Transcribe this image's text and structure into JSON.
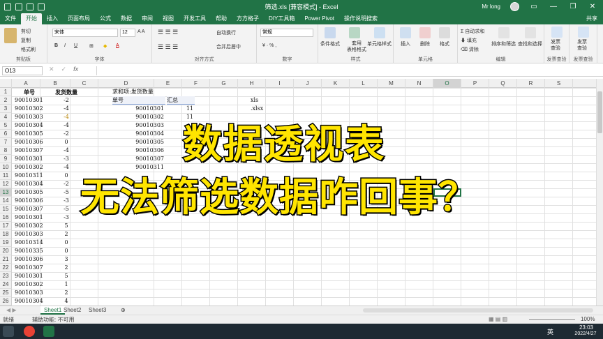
{
  "window": {
    "title": "筛选.xls [兼容模式] - Excel",
    "user": "Mr long",
    "share": "共享"
  },
  "tabs": [
    "文件",
    "开始",
    "插入",
    "页面布局",
    "公式",
    "数据",
    "审阅",
    "视图",
    "开发工具",
    "帮助",
    "方方格子",
    "DIY工具箱",
    "Power Pivot",
    "操作说明搜索"
  ],
  "ribbon": {
    "clipboard": {
      "label": "剪贴板",
      "cut": "剪切",
      "copy": "复制",
      "painter": "格式刷"
    },
    "font": {
      "label": "字体",
      "name": "宋体",
      "size": "12"
    },
    "align": {
      "label": "对齐方式",
      "wrap": "自动换行",
      "merge": "合并后居中"
    },
    "number": {
      "label": "数字",
      "format": "常规"
    },
    "styles": {
      "label": "样式",
      "cond": "条件格式",
      "table": "套用\n表格格式",
      "cell": "单元格样式"
    },
    "cells": {
      "label": "单元格",
      "insert": "插入",
      "delete": "删除",
      "format": "格式"
    },
    "editing": {
      "label": "编辑",
      "autosum": "自动求和",
      "fill": "填充",
      "clear": "清除",
      "sort": "排序和筛选",
      "find": "查找和选择"
    },
    "invoice1": {
      "label": "发票查验",
      "btn": "发票\n查验"
    },
    "invoice2": {
      "label": "发票查验",
      "btn": "发票\n查验"
    }
  },
  "namebox": "O13",
  "columns": [
    "A",
    "B",
    "C",
    "D",
    "E",
    "F",
    "G",
    "H",
    "I",
    "J",
    "K",
    "L",
    "M",
    "N",
    "O",
    "P",
    "Q",
    "R",
    "S"
  ],
  "rows": [
    "1",
    "2",
    "3",
    "4",
    "5",
    "6",
    "7",
    "8",
    "9",
    "10",
    "11",
    "12",
    "13",
    "14",
    "15",
    "16",
    "17",
    "18",
    "19",
    "20",
    "21",
    "22",
    "23",
    "24",
    "25",
    "26",
    "27"
  ],
  "sheet": {
    "colA": [
      "单号",
      "90010301",
      "90010302",
      "90010303",
      "90010304",
      "90010305",
      "90010306",
      "90010307",
      "90010301",
      "90010302",
      "90010311",
      "90010304",
      "90010305",
      "90010306",
      "90010307",
      "90010301",
      "90010302",
      "90010303",
      "90010314",
      "90010335",
      "90010306",
      "90010307",
      "90010301",
      "90010302",
      "90010303",
      "90010304",
      "90010315"
    ],
    "colB": [
      "发货数量",
      "-2",
      "-4",
      "-4",
      "-4",
      "-2",
      "0",
      "-4",
      "-3",
      "-4",
      "0",
      "-2",
      "-5",
      "-3",
      "-5",
      "-3",
      "5",
      "2",
      "0",
      "0",
      "3",
      "2",
      "5",
      "1",
      "2",
      "4",
      "0"
    ],
    "pivot": {
      "title": "求和项:发货数量",
      "rowlabel": "单号",
      "sumlabel": "汇总",
      "keys": [
        "90010301",
        "90010302",
        "90010303",
        "90010304",
        "90010305",
        "90010306",
        "90010307",
        "90010311"
      ],
      "vals": [
        "11",
        "11"
      ]
    },
    "H2": "xls",
    "H3": ".xlsx"
  },
  "sheets": [
    "Sheet1",
    "Sheet2",
    "Sheet3"
  ],
  "status": {
    "ready": "就绪",
    "accessibility": "辅助功能: 不可用",
    "zoom": "100%"
  },
  "taskbar": {
    "time": "23:03",
    "date": "2022/4/27",
    "ime": "英"
  },
  "overlay": {
    "line1": "数据透视表",
    "line2": "无法筛选数据咋回事？"
  },
  "colors": {
    "excel_green": "#217346",
    "overlay_yellow": "#ffe500"
  }
}
